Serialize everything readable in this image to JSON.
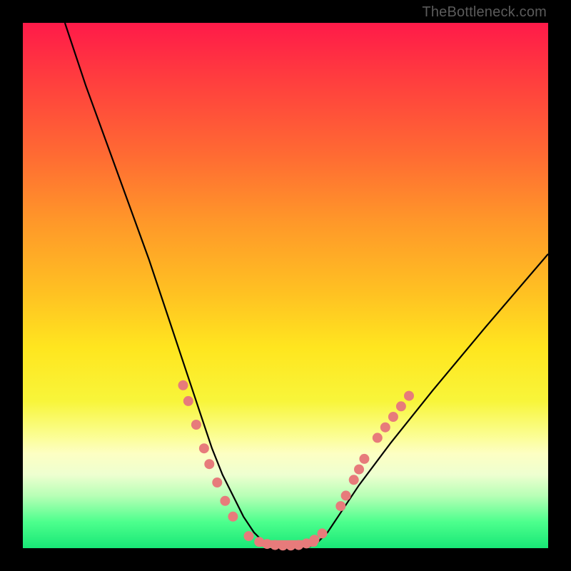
{
  "attribution": "TheBottleneck.com",
  "chart_data": {
    "type": "line",
    "title": "",
    "xlabel": "",
    "ylabel": "",
    "xlim": [
      0,
      100
    ],
    "ylim": [
      0,
      100
    ],
    "series": [
      {
        "name": "bottleneck-curve",
        "x": [
          8,
          12,
          16,
          20,
          24,
          28,
          30,
          32,
          34,
          36,
          38,
          40,
          42,
          44,
          46,
          48,
          50,
          52,
          54,
          56,
          58,
          60,
          64,
          70,
          78,
          88,
          100
        ],
        "y": [
          100,
          88,
          77,
          66,
          55,
          43,
          37,
          31,
          25,
          19,
          14,
          10,
          6,
          3,
          1,
          0,
          0,
          0,
          0,
          1,
          3,
          6,
          12,
          20,
          30,
          42,
          56
        ]
      }
    ],
    "markers": {
      "name": "highlight-dots",
      "color": "#e77b7b",
      "points": [
        {
          "x": 30.5,
          "y": 31
        },
        {
          "x": 31.5,
          "y": 28
        },
        {
          "x": 33.0,
          "y": 23.5
        },
        {
          "x": 34.5,
          "y": 19
        },
        {
          "x": 35.5,
          "y": 16
        },
        {
          "x": 37.0,
          "y": 12.5
        },
        {
          "x": 38.5,
          "y": 9
        },
        {
          "x": 40.0,
          "y": 6
        },
        {
          "x": 43.0,
          "y": 2.3
        },
        {
          "x": 45.0,
          "y": 1.2
        },
        {
          "x": 46.5,
          "y": 0.8
        },
        {
          "x": 48.0,
          "y": 0.6
        },
        {
          "x": 49.5,
          "y": 0.5
        },
        {
          "x": 51.0,
          "y": 0.5
        },
        {
          "x": 52.5,
          "y": 0.6
        },
        {
          "x": 54.0,
          "y": 0.9
        },
        {
          "x": 55.5,
          "y": 1.6
        },
        {
          "x": 57.0,
          "y": 2.8
        },
        {
          "x": 60.5,
          "y": 8
        },
        {
          "x": 61.5,
          "y": 10
        },
        {
          "x": 63.0,
          "y": 13
        },
        {
          "x": 64.0,
          "y": 15
        },
        {
          "x": 65.0,
          "y": 17
        },
        {
          "x": 67.5,
          "y": 21
        },
        {
          "x": 69.0,
          "y": 23
        },
        {
          "x": 70.5,
          "y": 25
        },
        {
          "x": 72.0,
          "y": 27
        },
        {
          "x": 73.5,
          "y": 29
        }
      ]
    }
  }
}
